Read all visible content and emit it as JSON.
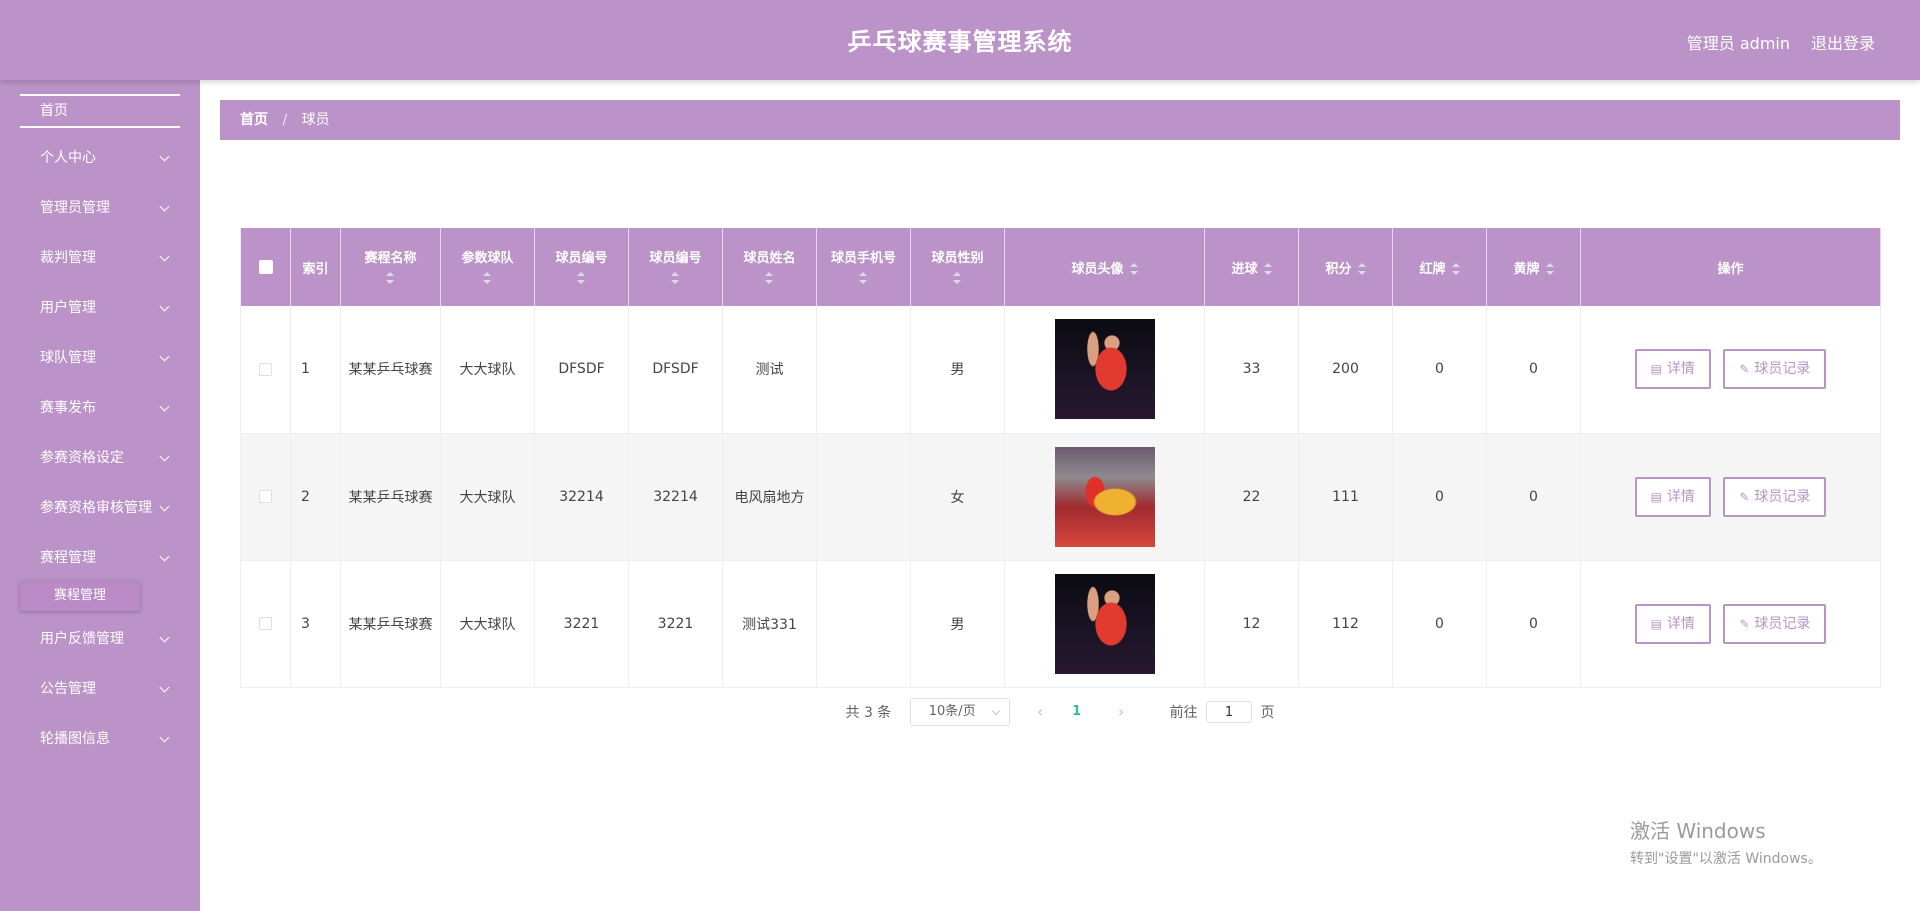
{
  "header": {
    "title": "乒乓球赛事管理系统",
    "user_label": "管理员 admin",
    "logout_label": "退出登录"
  },
  "sidebar": {
    "home": "首页",
    "items": [
      {
        "label": "个人中心"
      },
      {
        "label": "管理员管理"
      },
      {
        "label": "裁判管理"
      },
      {
        "label": "用户管理"
      },
      {
        "label": "球队管理"
      },
      {
        "label": "赛事发布"
      },
      {
        "label": "参赛资格设定"
      },
      {
        "label": "参赛资格审核管理"
      },
      {
        "label": "赛程管理"
      },
      {
        "label": "用户反馈管理"
      },
      {
        "label": "公告管理"
      },
      {
        "label": "轮播图信息"
      }
    ],
    "active_sub": "赛程管理"
  },
  "breadcrumb": {
    "home": "首页",
    "separator": "/",
    "current": "球员"
  },
  "table": {
    "headers": {
      "index": "索引",
      "match_name": "赛程名称",
      "team": "参数球队",
      "player_no_1": "球员编号",
      "player_no_2": "球员编号",
      "player_name": "球员姓名",
      "phone": "球员手机号",
      "gender": "球员性别",
      "avatar": "球员头像",
      "goals": "进球",
      "points": "积分",
      "red_card": "红牌",
      "yellow_card": "黄牌",
      "actions": "操作"
    },
    "rows": [
      {
        "index": "1",
        "match_name": "某某乒乓球赛",
        "team": "大大球队",
        "player_no_1": "DFSDF",
        "player_no_2": "DFSDF",
        "player_name": "测试",
        "phone": "",
        "gender": "男",
        "avatar": "player-photo-1",
        "goals": "33",
        "points": "200",
        "red_card": "0",
        "yellow_card": "0"
      },
      {
        "index": "2",
        "match_name": "某某乒乓球赛",
        "team": "大大球队",
        "player_no_1": "32214",
        "player_no_2": "32214",
        "player_name": "电风扇地方",
        "phone": "",
        "gender": "女",
        "avatar": "player-photo-2",
        "goals": "22",
        "points": "111",
        "red_card": "0",
        "yellow_card": "0"
      },
      {
        "index": "3",
        "match_name": "某某乒乓球赛",
        "team": "大大球队",
        "player_no_1": "3221",
        "player_no_2": "3221",
        "player_name": "测试331",
        "phone": "",
        "gender": "男",
        "avatar": "player-photo-1",
        "goals": "12",
        "points": "112",
        "red_card": "0",
        "yellow_card": "0"
      }
    ],
    "detail_label": "详情",
    "record_label": "球员记录"
  },
  "pagination": {
    "total": "共 3 条",
    "page_size": "10条/页",
    "prev": "‹",
    "current_page": "1",
    "next": "›",
    "goto_label": "前往",
    "goto_value": "1",
    "goto_suffix": "页"
  },
  "watermark": {
    "line1": "激活 Windows",
    "line2": "转到\"设置\"以激活 Windows。"
  },
  "colors": {
    "primary": "#bb93c8",
    "active_page": "#2ebf91"
  }
}
